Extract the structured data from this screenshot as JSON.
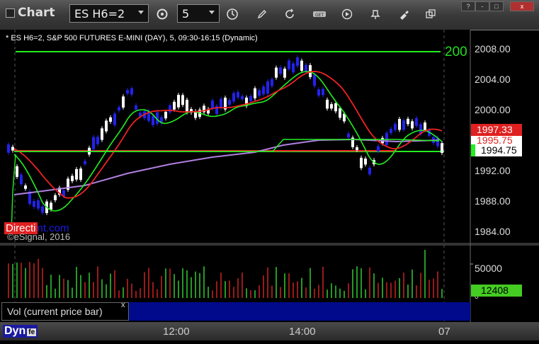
{
  "window": {
    "title": "Chart",
    "symbol": "ES H6=2",
    "interval": "5",
    "minimize": "-",
    "maximize": "□",
    "help": "?",
    "close": "x"
  },
  "chart": {
    "legend": "* ES H6=2, S&P 500 FUTURES E-MINI (DAY), 5, 09:30-16:15 (Dynamic)",
    "watermark": "©eSignal, 2016",
    "brand_part1": "Directi",
    "brand_part2": "nt.com",
    "level_tag": "200",
    "price_axis": [
      "2008.00",
      "2004.00",
      "2000.00",
      "1992.00",
      "1988.00",
      "1984.00"
    ],
    "price_boxes": {
      "red": "1997.33",
      "white_red": "1995.75",
      "white": "1994.75"
    }
  },
  "volume": {
    "label": "Vol (current price bar)",
    "close": "x",
    "axis": [
      "50000",
      "0"
    ],
    "current": "12408"
  },
  "time_axis": [
    "12:00",
    "14:00",
    "07"
  ],
  "bottom": {
    "dyn": "Dyn",
    "fe": "fe"
  },
  "colors": {
    "up_candle": "#ffffff",
    "down_candle": "#2222ee",
    "ema_fast": "#22ee22",
    "ema_slow": "#ee2222",
    "vwap": "#b080e0",
    "level": "#22ee22"
  },
  "icons": [
    "symbol-dropdown-icon",
    "interval-gear-icon",
    "interval-dropdown-icon",
    "clock-icon",
    "pencil-icon",
    "refresh-icon",
    "link-icon",
    "play-icon",
    "brush-icon",
    "pin-icon",
    "restore-icon"
  ]
}
